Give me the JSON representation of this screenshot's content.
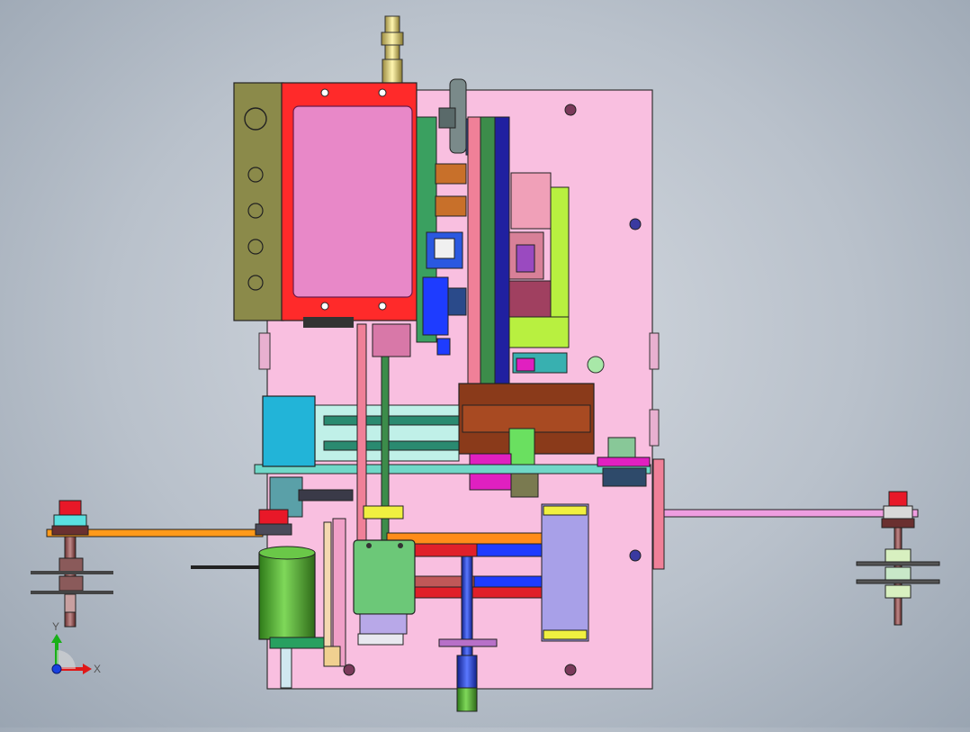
{
  "viewport": {
    "background_top": "#d4d9e0",
    "background_bottom": "#9aa5b2"
  },
  "triad": {
    "x_label": "X",
    "y_label": "Y",
    "x_color": "#e01818",
    "y_color": "#18b018",
    "z_color": "#1840e0"
  },
  "colors": {
    "base_plate": "#f9bfe0",
    "motor_housing": "#8b8a4a",
    "control_box_frame": "#ff2a2a",
    "control_box_panel": "#e888c8",
    "rail_orange": "#ff8c1a",
    "rail_blue": "#1e3cff",
    "rail_red": "#e0202a",
    "cylinder_green": "#4caf2a",
    "block_lavender": "#a8a0e8",
    "actuator_cyan": "#22b4d8",
    "slide_lime": "#b8f040",
    "bracket_magenta": "#e020c0",
    "hub_red": "#e81828"
  }
}
